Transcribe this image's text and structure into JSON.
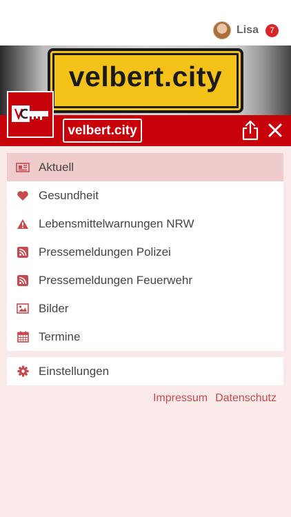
{
  "header": {
    "user_name": "Lisa",
    "notification_count": "7"
  },
  "hero": {
    "sign_text": "velbert.city"
  },
  "brand": {
    "logo_text": "velbert.city"
  },
  "menu": {
    "items": [
      {
        "label": "Aktuell",
        "icon": "newspaper-icon",
        "active": true
      },
      {
        "label": "Gesundheit",
        "icon": "heart-icon"
      },
      {
        "label": "Lebensmittelwarnungen NRW",
        "icon": "warning-icon"
      },
      {
        "label": "Pressemeldungen Polizei",
        "icon": "rss-icon"
      },
      {
        "label": "Pressemeldungen Feuerwehr",
        "icon": "rss-icon"
      },
      {
        "label": "Bilder",
        "icon": "image-icon"
      },
      {
        "label": "Termine",
        "icon": "calendar-icon"
      }
    ],
    "settings": {
      "label": "Einstellungen",
      "icon": "gear-icon"
    }
  },
  "footer": {
    "impressum": "Impressum",
    "datenschutz": "Datenschutz"
  },
  "colors": {
    "brand_red": "#c8020a",
    "accent_red": "#c54a4e",
    "active_row": "#f0cbcb",
    "background": "#f9e9e9",
    "badge": "#d9262b",
    "sign_yellow": "#f5c21a"
  }
}
